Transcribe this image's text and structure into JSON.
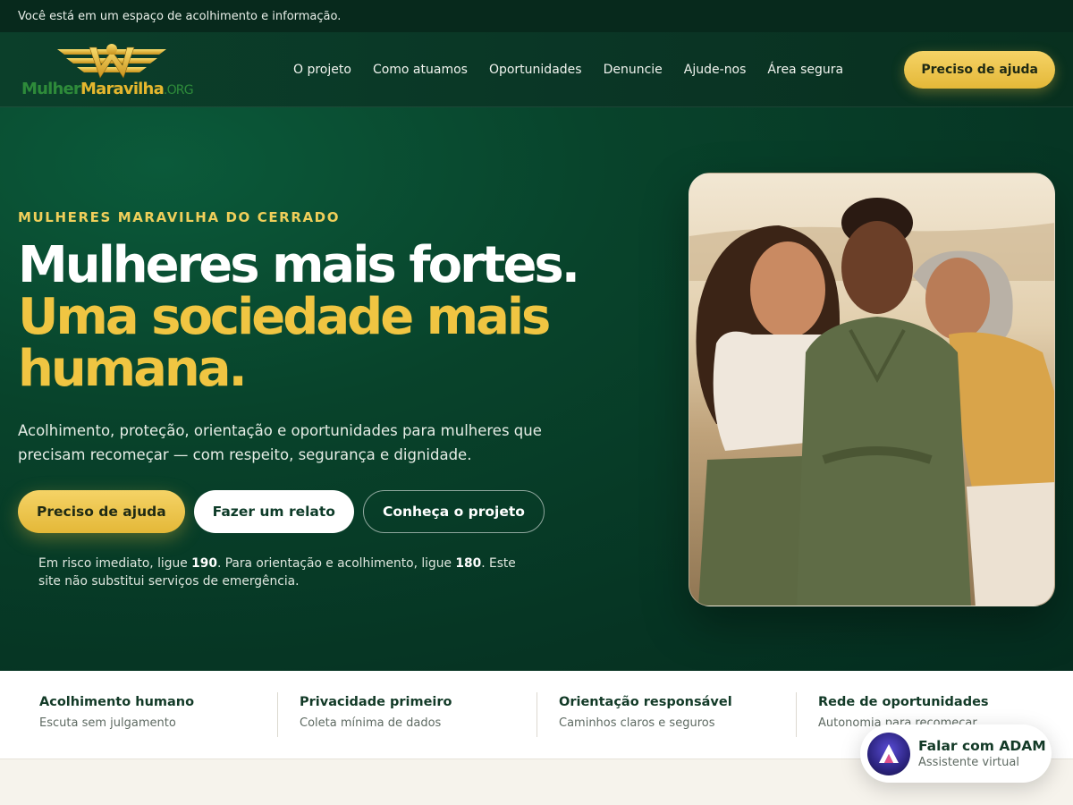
{
  "topbar": {
    "message": "Você está em um espaço de acolhimento e informação."
  },
  "header": {
    "logo": {
      "part1": "Mulher",
      "part2": "Maravilha",
      "part3": ".ORG"
    },
    "nav": [
      {
        "label": "O projeto"
      },
      {
        "label": "Como atuamos"
      },
      {
        "label": "Oportunidades"
      },
      {
        "label": "Denuncie"
      },
      {
        "label": "Ajude-nos"
      },
      {
        "label": "Área segura"
      }
    ],
    "cta_label": "Preciso de ajuda"
  },
  "hero": {
    "eyebrow": "MULHERES MARAVILHA DO CERRADO",
    "headline_line1": "Mulheres mais fortes.",
    "headline_line2": "Uma sociedade mais humana.",
    "subtitle": "Acolhimento, proteção, orientação e oportunidades para mulheres que precisam recomeçar — com respeito, segurança e dignidade.",
    "buttons": {
      "primary": "Preciso de ajuda",
      "secondary": "Fazer um relato",
      "tertiary": "Conheça o projeto"
    },
    "note": {
      "part1": "Em risco imediato, ligue ",
      "num1": "190",
      "part2": ". Para orientação e acolhimento, ligue ",
      "num2": "180",
      "part3": ". Este site não substitui serviços de emergência."
    }
  },
  "features": [
    {
      "title": "Acolhimento humano",
      "desc": "Escuta sem julgamento"
    },
    {
      "title": "Privacidade primeiro",
      "desc": "Coleta mínima de dados"
    },
    {
      "title": "Orientação responsável",
      "desc": "Caminhos claros e seguros"
    },
    {
      "title": "Rede de oportunidades",
      "desc": "Autonomia para recomeçar"
    }
  ],
  "chat": {
    "title": "Falar com ADAM",
    "subtitle": "Assistente virtual"
  },
  "colors": {
    "brand_green": "#0b3f2a",
    "accent_gold": "#f0c542",
    "top_bar": "#07291c"
  }
}
